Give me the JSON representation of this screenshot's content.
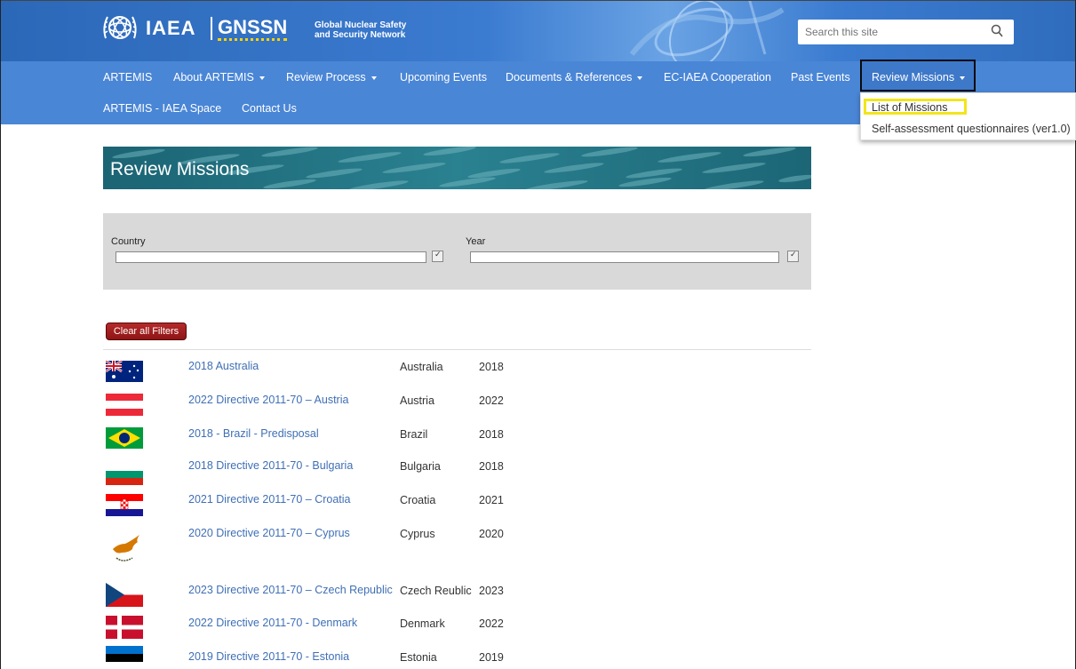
{
  "header": {
    "logo_iaea": "IAEA",
    "logo_gnssn": "GNSSN",
    "logo_subtitle_line1": "Global Nuclear Safety",
    "logo_subtitle_line2": "and Security Network",
    "search_placeholder": "Search this site",
    "search_icon": "magnifier-icon"
  },
  "nav": {
    "items": [
      {
        "label": "ARTEMIS"
      },
      {
        "label": "About ARTEMIS",
        "dropdown": true
      },
      {
        "label": "Review Process",
        "dropdown": true
      },
      {
        "label": "Upcoming Events"
      },
      {
        "label": "Documents & References",
        "dropdown": true
      },
      {
        "label": "EC-IAEA Cooperation"
      },
      {
        "label": "Past Events"
      },
      {
        "label": "Review Missions",
        "dropdown": true,
        "active": true
      },
      {
        "label": "ARTEMIS - IAEA Space"
      },
      {
        "label": "Contact Us"
      }
    ],
    "dropdown_options": [
      "List of Missions",
      "Self-assessment questionnaires (ver1.0)"
    ],
    "highlight_color": "#f2e51a"
  },
  "page": {
    "title": "Review Missions",
    "filters": {
      "country_label": "Country",
      "year_label": "Year"
    },
    "clear_button": "Clear all Filters"
  },
  "missions": [
    {
      "title": "2018 Australia",
      "country": "Australia",
      "year": "2018",
      "flag": "australia-flag"
    },
    {
      "title": "2022 Directive 2011-70 – Austria",
      "country": "Austria",
      "year": "2022",
      "flag": "austria-flag"
    },
    {
      "title": "2018 - Brazil - Predisposal",
      "country": "Brazil",
      "year": "2018",
      "flag": "brazil-flag"
    },
    {
      "title": "2018 Directive 2011-70 - Bulgaria",
      "country": "Bulgaria",
      "year": "2018",
      "flag": "bulgaria-flag"
    },
    {
      "title": "2021 Directive 2011-70 – Croatia",
      "country": "Croatia",
      "year": "2021",
      "flag": "croatia-flag"
    },
    {
      "title": "2020 Directive 2011-70 – Cyprus",
      "country": "Cyprus",
      "year": "2020",
      "flag": "cyprus-flag"
    },
    {
      "title": "2023 Directive 2011-70 – Czech Republic",
      "country": "Czech Reublic",
      "year": "2023",
      "flag": "czech-flag"
    },
    {
      "title": "2022 Directive 2011-70 - Denmark",
      "country": "Denmark",
      "year": "2022",
      "flag": "denmark-flag"
    },
    {
      "title": "2019 Directive 2011-70 - Estonia",
      "country": "Estonia",
      "year": "2019",
      "flag": "estonia-flag"
    }
  ]
}
